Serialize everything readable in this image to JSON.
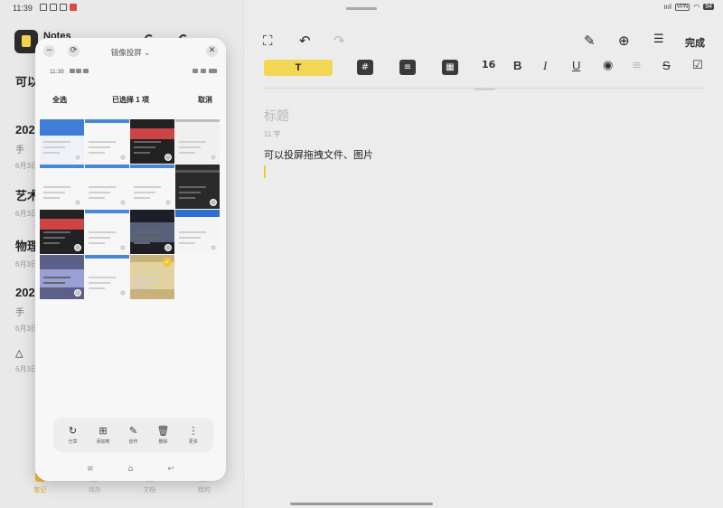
{
  "status_bar": {
    "time": "11:39",
    "network": "ıııl",
    "vpn": "VPN",
    "battery": "94"
  },
  "left_panel": {
    "app_title": "Notes",
    "notes": [
      {
        "title": "可以",
        "sub": "",
        "date": ""
      },
      {
        "title": "202",
        "sub": "手",
        "date": "6月3日"
      },
      {
        "title": "艺术",
        "sub": "",
        "date": "6月3日"
      },
      {
        "title": "物理",
        "sub": "",
        "date": "6月3日"
      },
      {
        "title": "202",
        "sub": "手",
        "date": "6月3日"
      },
      {
        "title": "△",
        "sub": "",
        "date": "6月3日"
      }
    ],
    "bottom_nav": [
      "笔记",
      "待办",
      "文档",
      "我的"
    ]
  },
  "editor": {
    "done_label": "完成",
    "text_style_label": "T",
    "font_size": "16",
    "bold": "B",
    "italic": "I",
    "underline": "U",
    "strike": "S",
    "heading_box": "#",
    "title_placeholder": "标题",
    "char_count": "11 字",
    "body_text": "可以投屏拖拽文件、图片"
  },
  "projection": {
    "title": "镜像投屏 ⌄",
    "status_time": "11:39",
    "select_all": "全选",
    "selected_count": "已选择 1 项",
    "cancel": "取消",
    "toolbar": [
      {
        "icon": "share-icon",
        "glyph": "↻",
        "label": "分享"
      },
      {
        "icon": "add-to-icon",
        "glyph": "⊞",
        "label": "添加到"
      },
      {
        "icon": "edit-icon",
        "glyph": "✎",
        "label": "创作"
      },
      {
        "icon": "trash-icon",
        "glyph": "🗑",
        "label": "删除"
      },
      {
        "icon": "more-icon",
        "glyph": "⋮",
        "label": "更多"
      }
    ],
    "thumbnails": [
      {
        "kind": "blue",
        "selected": false
      },
      {
        "kind": "light",
        "selected": false
      },
      {
        "kind": "dark-app",
        "selected": false
      },
      {
        "kind": "settings",
        "selected": false
      },
      {
        "kind": "light",
        "selected": false
      },
      {
        "kind": "light",
        "selected": false
      },
      {
        "kind": "light",
        "selected": false
      },
      {
        "kind": "list",
        "selected": false
      },
      {
        "kind": "dark-app",
        "selected": false
      },
      {
        "kind": "light",
        "selected": false
      },
      {
        "kind": "dark-photo",
        "selected": false
      },
      {
        "kind": "blue-list",
        "selected": false
      },
      {
        "kind": "wallpaper",
        "selected": false
      },
      {
        "kind": "light",
        "selected": false
      },
      {
        "kind": "food-photo",
        "selected": true
      }
    ]
  },
  "colors": {
    "accent": "#f2d655",
    "check": "#f2c633"
  }
}
